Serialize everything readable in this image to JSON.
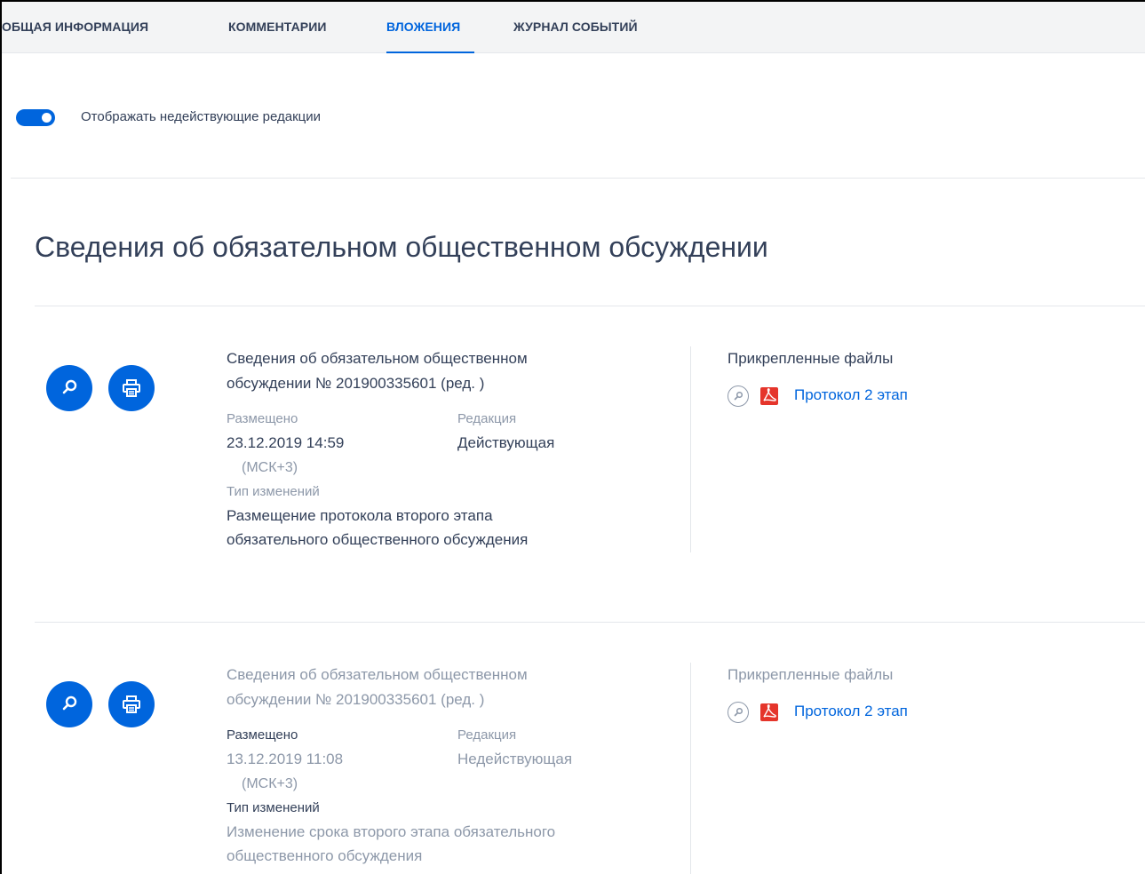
{
  "tabs": [
    {
      "label": "ОБЩАЯ ИНФОРМАЦИЯ"
    },
    {
      "label": "КОММЕНТАРИИ"
    },
    {
      "label": "ВЛОЖЕНИЯ"
    },
    {
      "label": "ЖУРНАЛ СОБЫТИЙ"
    }
  ],
  "active_tab": "ВЛОЖЕНИЯ",
  "toggle": {
    "label": "Отображать недействующие редакции",
    "on": true
  },
  "section_title": "Сведения об обязательном общественном обсуждении",
  "records": [
    {
      "title_line1": "Сведения об обязательном общественном",
      "title_line2": "обсуждении № 201900335601 (ред. )",
      "placed_label": "Размещено",
      "placed_date": "23.12.2019 14:59",
      "placed_tz": "(МСК+3)",
      "edition_label": "Редакция",
      "edition_value": "Действующая",
      "change_label": "Тип изменений",
      "change_line1": "Размещение протокола второго этапа",
      "change_line2": "обязательного общественного обсуждения",
      "files_label": "Прикрепленные файлы",
      "file_name": "Протокол 2 этап"
    },
    {
      "title_line1": "Сведения об обязательном общественном",
      "title_line2": "обсуждении № 201900335601 (ред. )",
      "placed_label": "Размещено",
      "placed_date": "13.12.2019 11:08",
      "placed_tz": "(МСК+3)",
      "edition_label": "Редакция",
      "edition_value": "Недействующая",
      "change_label": "Тип изменений",
      "change_line1": "Изменение срока второго этапа обязательного",
      "change_line2": "общественного обсуждения",
      "files_label": "Прикрепленные файлы",
      "file_name": "Протокол 2 этап"
    }
  ],
  "colors": {
    "accent": "#0065dd",
    "text": "#334059",
    "muted": "#8d98a9",
    "pdf": "#e5352b"
  },
  "icons": {
    "view": "magnifier-icon",
    "print": "printer-icon",
    "signature": "signature-key-icon",
    "pdf": "pdf-file-icon"
  }
}
